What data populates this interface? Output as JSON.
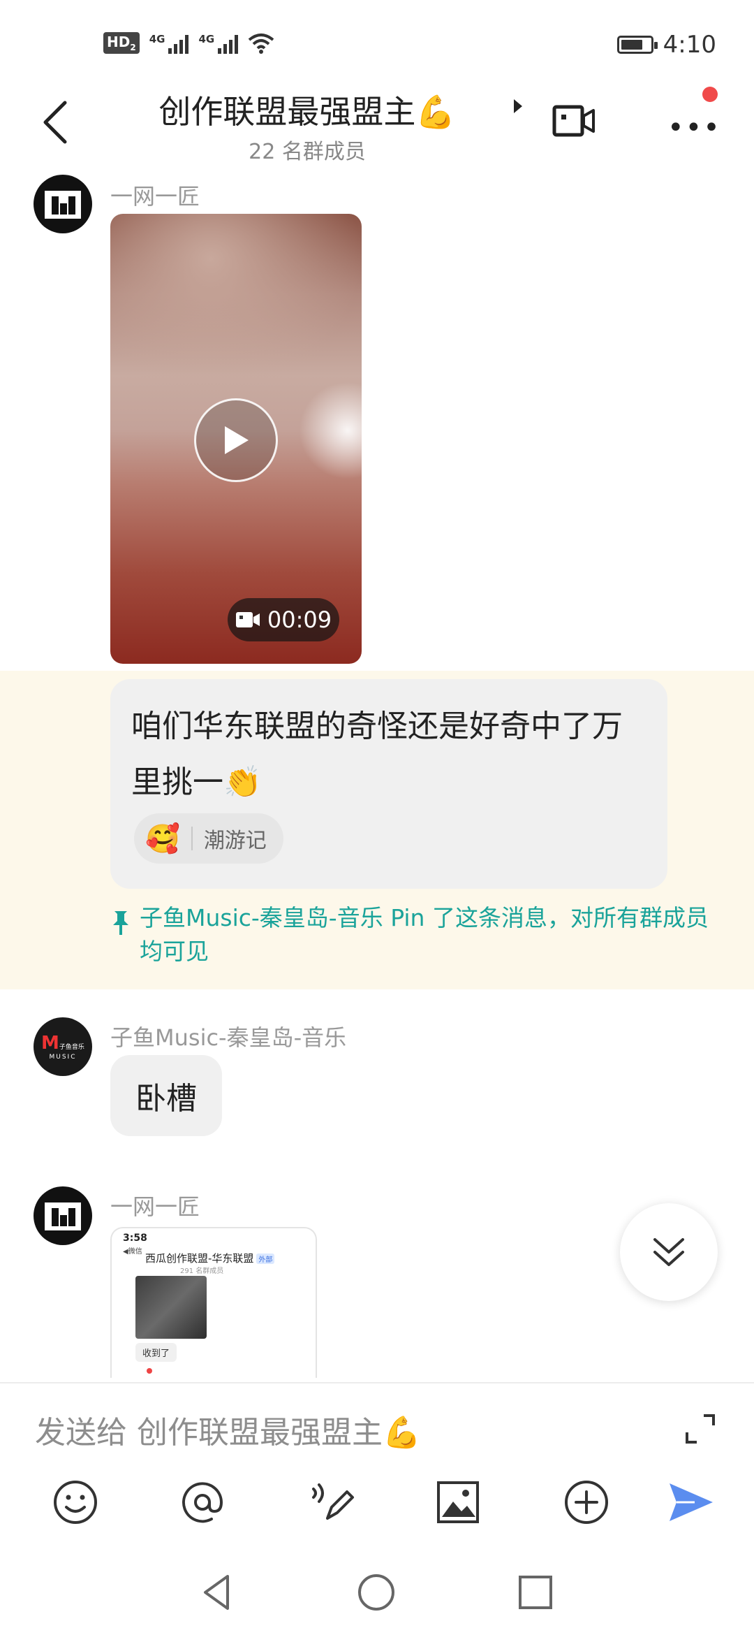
{
  "status_bar": {
    "hd_label": "HD",
    "hd_sub": "2",
    "network1": "4G",
    "network2": "4G",
    "time": "4:10",
    "battery_level": 0.75
  },
  "header": {
    "title": "创作联盟最强盟主💪",
    "member_count": "22 名群成员"
  },
  "messages": [
    {
      "sender": "一网一匠",
      "type": "video",
      "duration": "00:09"
    },
    {
      "type": "pinned_text",
      "text": "咱们华东联盟的奇怪还是好奇中了万里挑一👏",
      "reaction_emoji": "🥰",
      "reaction_user": "潮游记",
      "pin_note": "子鱼Music-秦皇岛-音乐 Pin 了这条消息，对所有群成员均可见"
    },
    {
      "sender": "子鱼Music-秦皇岛-音乐",
      "type": "text",
      "text": "卧槽",
      "avatar_text": "M 子鱼音乐 MUSIC"
    },
    {
      "sender": "一网一匠",
      "type": "image",
      "preview": {
        "status_time": "3:58",
        "status_app": "◀微信",
        "title": "西瓜创作联盟-华东联盟",
        "tag": "外部",
        "sub": "291 名群成员",
        "bubble": "收到了"
      }
    }
  ],
  "input": {
    "placeholder": "发送给 创作联盟最强盟主💪"
  },
  "toolbar": {
    "items": [
      "emoji-icon",
      "mention-icon",
      "voice-to-text-icon",
      "image-icon",
      "plus-icon",
      "send-icon"
    ],
    "accent": "#5b8def"
  },
  "colors": {
    "pin_accent": "#1aa39a",
    "pinned_background": "#fdf8ea",
    "notification_dot": "#f04a4a"
  }
}
